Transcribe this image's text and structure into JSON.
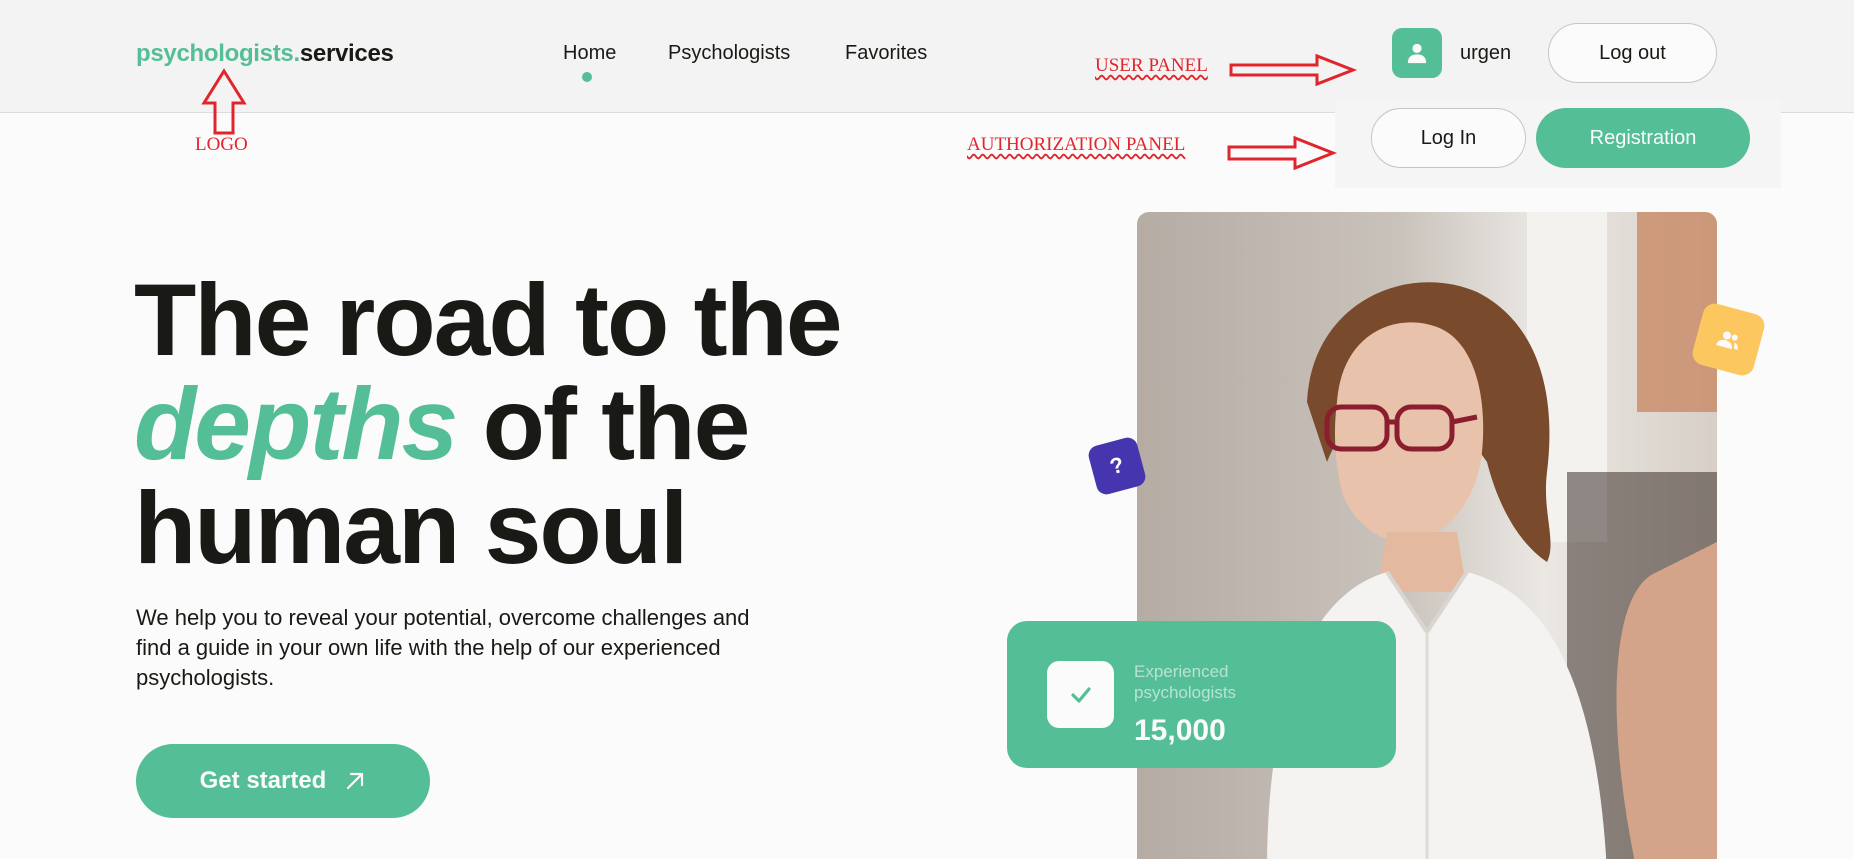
{
  "header": {
    "logo": {
      "accent": "psychologists.",
      "main": "services"
    },
    "nav": [
      "Home",
      "Psychologists",
      "Favorites"
    ],
    "user": {
      "name": "urgen",
      "logout_label": "Log out",
      "avatar_icon": "user-icon"
    },
    "auth": {
      "login_label": "Log In",
      "register_label": "Registration"
    }
  },
  "annotations": {
    "user_panel": "USER PANEL",
    "auth_panel": "AUTHORIZATION PANEL",
    "logo": "LOGO"
  },
  "hero": {
    "title_line1": "The road to the",
    "title_accent": "depths",
    "title_line2_rest": " of the",
    "title_line3": "human soul",
    "subtitle": "We help you to reveal your potential, overcome challenges and find a guide in your own life with the help of our experienced psychologists.",
    "cta_label": "Get started",
    "cta_icon": "arrow-up-right-icon"
  },
  "stats": {
    "label": "Experienced psychologists",
    "value": "15,000",
    "icon": "check-icon"
  },
  "badges": {
    "question": "?",
    "question_icon": "question-icon",
    "users_icon": "users-icon"
  },
  "colors": {
    "accent": "#54be96",
    "text": "#191a15",
    "background": "#fbfbfb",
    "annotation": "#e0262c",
    "question_badge": "#4535af",
    "users_badge": "#fbc75e"
  }
}
